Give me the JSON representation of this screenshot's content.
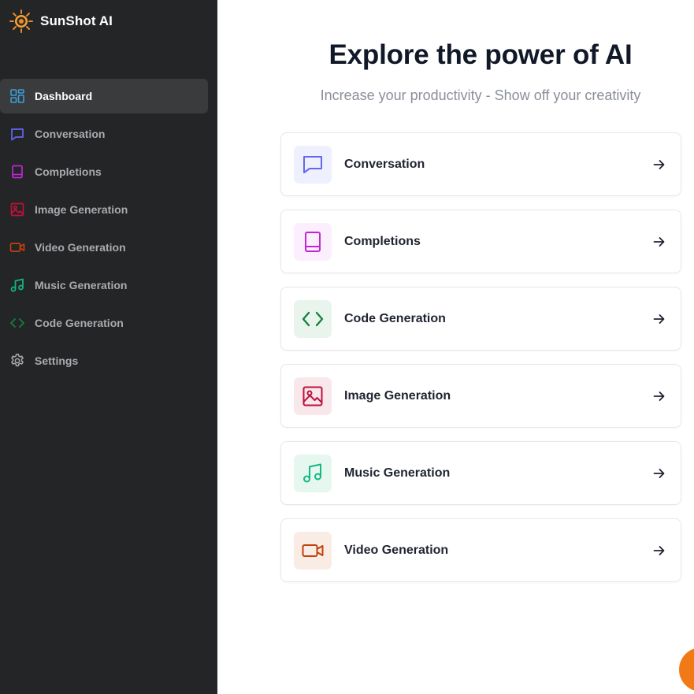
{
  "app": {
    "name": "SunShot AI"
  },
  "sidebar": {
    "items": [
      {
        "label": "Dashboard",
        "icon": "dashboard-grid-icon",
        "color": "#3b9fd8",
        "active": true
      },
      {
        "label": "Conversation",
        "icon": "chat-bubble-icon",
        "color": "#6366f1"
      },
      {
        "label": "Completions",
        "icon": "book-icon",
        "color": "#c026d3"
      },
      {
        "label": "Image Generation",
        "icon": "image-icon",
        "color": "#be123c"
      },
      {
        "label": "Video Generation",
        "icon": "video-camera-icon",
        "color": "#c2410c"
      },
      {
        "label": "Music Generation",
        "icon": "music-note-icon",
        "color": "#10b981"
      },
      {
        "label": "Code Generation",
        "icon": "code-brackets-icon",
        "color": "#15803d"
      },
      {
        "label": "Settings",
        "icon": "gear-icon",
        "color": "#a9abb0"
      }
    ]
  },
  "main": {
    "title": "Explore the power of AI",
    "subtitle": "Increase your productivity - Show off your creativity",
    "cards": [
      {
        "label": "Conversation",
        "icon": "chat-bubble-icon",
        "color": "#6366f1",
        "bg": "#eef0fd"
      },
      {
        "label": "Completions",
        "icon": "book-icon",
        "color": "#c026d3",
        "bg": "#fbeefd"
      },
      {
        "label": "Code Generation",
        "icon": "code-brackets-icon",
        "color": "#15803d",
        "bg": "#e9f4ec"
      },
      {
        "label": "Image Generation",
        "icon": "image-icon",
        "color": "#be123c",
        "bg": "#f8e8ec"
      },
      {
        "label": "Music Generation",
        "icon": "music-note-icon",
        "color": "#10b981",
        "bg": "#e6f7f0"
      },
      {
        "label": "Video Generation",
        "icon": "video-camera-icon",
        "color": "#c2410c",
        "bg": "#f9ece4"
      }
    ]
  },
  "colors": {
    "sidebar_bg": "#242526",
    "fab": "#f17a16"
  }
}
